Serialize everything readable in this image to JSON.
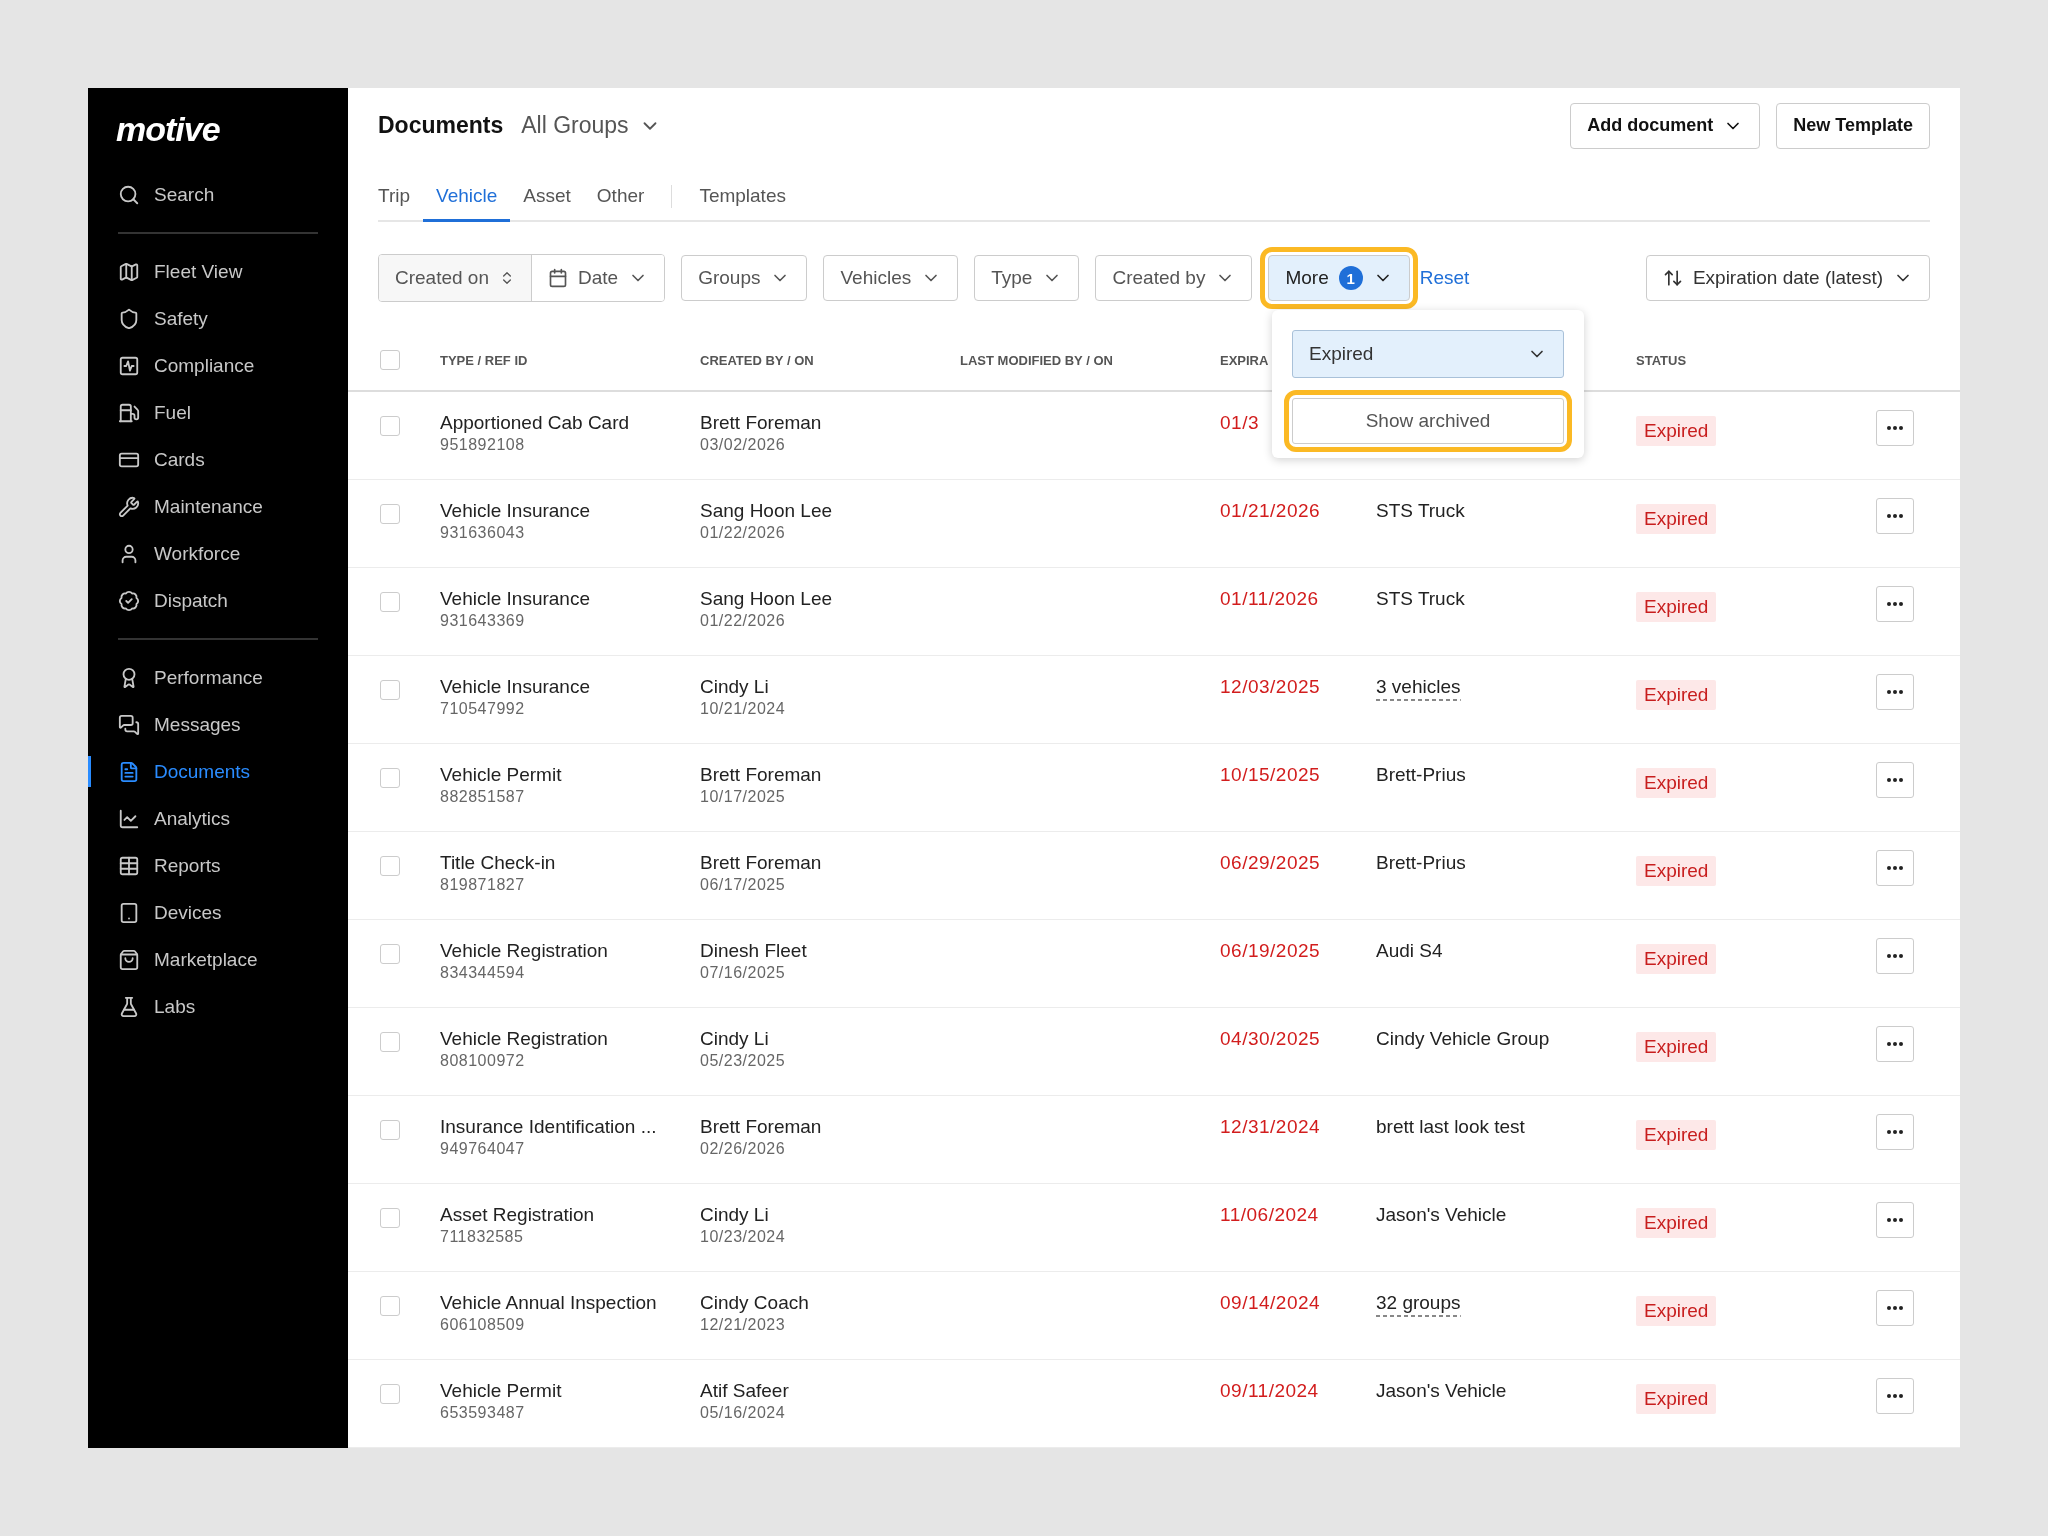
{
  "sidebar": {
    "logo": "motive",
    "search": "Search",
    "groups": [
      [
        {
          "label": "Fleet View",
          "selected": false
        },
        {
          "label": "Safety",
          "selected": false
        },
        {
          "label": "Compliance",
          "selected": false
        },
        {
          "label": "Fuel",
          "selected": false
        },
        {
          "label": "Cards",
          "selected": false
        },
        {
          "label": "Maintenance",
          "selected": false
        },
        {
          "label": "Workforce",
          "selected": false
        },
        {
          "label": "Dispatch",
          "selected": false
        }
      ],
      [
        {
          "label": "Performance",
          "selected": false
        },
        {
          "label": "Messages",
          "selected": false
        },
        {
          "label": "Documents",
          "selected": true
        },
        {
          "label": "Analytics",
          "selected": false
        },
        {
          "label": "Reports",
          "selected": false
        },
        {
          "label": "Devices",
          "selected": false
        },
        {
          "label": "Marketplace",
          "selected": false
        },
        {
          "label": "Labs",
          "selected": false
        }
      ]
    ]
  },
  "header": {
    "title": "Documents",
    "group_picker": "All Groups",
    "buttons": [
      {
        "label": "Add document",
        "kind": "dropdown"
      },
      {
        "label": "New Template",
        "kind": "plain"
      }
    ]
  },
  "tabs": [
    {
      "label": "Trip",
      "selected": false
    },
    {
      "label": "Vehicle",
      "selected": true
    },
    {
      "label": "Asset",
      "selected": false
    },
    {
      "label": "Other",
      "selected": false
    },
    {
      "label": "Templates",
      "selected": false
    }
  ],
  "filters": {
    "date_field": "Created on",
    "date": "Date",
    "dropdowns": [
      "Groups",
      "Vehicles",
      "Type",
      "Created by"
    ],
    "more": {
      "label": "More",
      "count": "1",
      "highlighted": true
    },
    "reset": "Reset",
    "sort": "Expiration date (latest)"
  },
  "more_menu": {
    "status_select": "Expired",
    "show_archived": {
      "label": "Show archived",
      "highlighted": true
    }
  },
  "table": {
    "select_all_checked": false,
    "columns": [
      "TYPE / REF ID",
      "CREATED BY / ON",
      "LAST MODIFIED BY / ON",
      "EXPIRA",
      "STATUS"
    ],
    "rows": [
      {
        "checked": false,
        "type": "Apportioned Cab Card",
        "ref": "951892108",
        "created_by": "Brett Foreman",
        "created_on": "03/02/2026",
        "expiration": "01/3",
        "status": "Expired"
      },
      {
        "checked": false,
        "type": "Vehicle Insurance",
        "ref": "931636043",
        "created_by": "Sang Hoon Lee",
        "created_on": "01/22/2026",
        "expiration": "01/21/2026",
        "assigned": "STS Truck",
        "underlined": false,
        "status": "Expired"
      },
      {
        "checked": false,
        "type": "Vehicle Insurance",
        "ref": "931643369",
        "created_by": "Sang Hoon Lee",
        "created_on": "01/22/2026",
        "expiration": "01/11/2026",
        "assigned": "STS Truck",
        "underlined": false,
        "status": "Expired"
      },
      {
        "checked": false,
        "type": "Vehicle Insurance",
        "ref": "710547992",
        "created_by": "Cindy Li",
        "created_on": "10/21/2024",
        "expiration": "12/03/2025",
        "assigned": "3 vehicles",
        "underlined": true,
        "status": "Expired"
      },
      {
        "checked": false,
        "type": "Vehicle Permit",
        "ref": "882851587",
        "created_by": "Brett Foreman",
        "created_on": "10/17/2025",
        "expiration": "10/15/2025",
        "assigned": "Brett-Prius",
        "underlined": false,
        "status": "Expired"
      },
      {
        "checked": false,
        "type": "Title Check-in",
        "ref": "819871827",
        "created_by": "Brett Foreman",
        "created_on": "06/17/2025",
        "expiration": "06/29/2025",
        "assigned": "Brett-Prius",
        "underlined": false,
        "status": "Expired"
      },
      {
        "checked": false,
        "type": "Vehicle Registration",
        "ref": "834344594",
        "created_by": "Dinesh Fleet",
        "created_on": "07/16/2025",
        "expiration": "06/19/2025",
        "assigned": "Audi S4",
        "underlined": false,
        "status": "Expired"
      },
      {
        "checked": false,
        "type": "Vehicle Registration",
        "ref": "808100972",
        "created_by": "Cindy Li",
        "created_on": "05/23/2025",
        "expiration": "04/30/2025",
        "assigned": "Cindy Vehicle Group",
        "underlined": false,
        "status": "Expired"
      },
      {
        "checked": false,
        "type": "Insurance Identification ...",
        "ref": "949764047",
        "created_by": "Brett Foreman",
        "created_on": "02/26/2026",
        "expiration": "12/31/2024",
        "assigned": "brett last look test",
        "underlined": false,
        "status": "Expired"
      },
      {
        "checked": false,
        "type": "Asset Registration",
        "ref": "711832585",
        "created_by": "Cindy Li",
        "created_on": "10/23/2024",
        "expiration": "11/06/2024",
        "assigned": "Jason's Vehicle",
        "underlined": false,
        "status": "Expired"
      },
      {
        "checked": false,
        "type": "Vehicle Annual Inspection",
        "ref": "606108509",
        "created_by": "Cindy Coach",
        "created_on": "12/21/2023",
        "expiration": "09/14/2024",
        "assigned": "32 groups",
        "underlined": true,
        "status": "Expired"
      },
      {
        "checked": false,
        "type": "Vehicle Permit",
        "ref": "653593487",
        "created_by": "Atif Safeer",
        "created_on": "05/16/2024",
        "expiration": "09/11/2024",
        "assigned": "Jason's Vehicle",
        "underlined": false,
        "status": "Expired"
      }
    ]
  }
}
